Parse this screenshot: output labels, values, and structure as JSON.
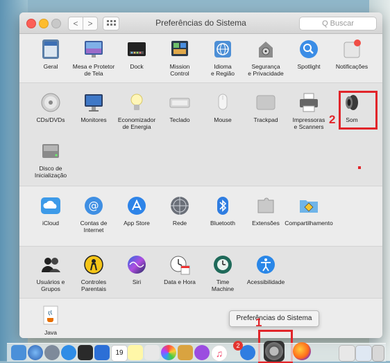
{
  "window": {
    "title": "Preferências do Sistema",
    "search_placeholder": "Q Buscar",
    "back_glyph": "<",
    "forward_glyph": ">"
  },
  "panes": {
    "row1": [
      {
        "label": "Geral",
        "icon": "general-icon"
      },
      {
        "label": "Mesa e Protetor\nde Tela",
        "icon": "desktop-screensaver-icon"
      },
      {
        "label": "Dock",
        "icon": "dock-icon"
      },
      {
        "label": "Mission\nControl",
        "icon": "mission-control-icon"
      },
      {
        "label": "Idioma\ne Região",
        "icon": "language-region-icon"
      },
      {
        "label": "Segurança\ne Privacidade",
        "icon": "security-icon"
      },
      {
        "label": "Spotlight",
        "icon": "spotlight-icon"
      },
      {
        "label": "Notificações",
        "icon": "notifications-icon"
      }
    ],
    "row2": [
      {
        "label": "CDs/DVDs",
        "icon": "cd-dvd-icon"
      },
      {
        "label": "Monitores",
        "icon": "displays-icon"
      },
      {
        "label": "Economizador\nde Energia",
        "icon": "energy-saver-icon"
      },
      {
        "label": "Teclado",
        "icon": "keyboard-icon"
      },
      {
        "label": "Mouse",
        "icon": "mouse-icon"
      },
      {
        "label": "Trackpad",
        "icon": "trackpad-icon"
      },
      {
        "label": "Impressoras\ne Scanners",
        "icon": "printer-icon"
      },
      {
        "label": "Som",
        "icon": "sound-icon"
      }
    ],
    "row2b": [
      {
        "label": "Disco de\nInicialização",
        "icon": "startup-disk-icon"
      }
    ],
    "row3": [
      {
        "label": "iCloud",
        "icon": "icloud-icon"
      },
      {
        "label": "Contas de\nInternet",
        "icon": "internet-accounts-icon"
      },
      {
        "label": "App Store",
        "icon": "app-store-icon"
      },
      {
        "label": "Rede",
        "icon": "network-icon"
      },
      {
        "label": "Bluetooth",
        "icon": "bluetooth-icon"
      },
      {
        "label": "Extensões",
        "icon": "extensions-icon"
      },
      {
        "label": "Compartilhamento",
        "icon": "sharing-icon"
      }
    ],
    "row4": [
      {
        "label": "Usuários e\nGrupos",
        "icon": "users-groups-icon"
      },
      {
        "label": "Controles\nParentais",
        "icon": "parental-controls-icon"
      },
      {
        "label": "Siri",
        "icon": "siri-icon"
      },
      {
        "label": "Data e Hora",
        "icon": "date-time-icon"
      },
      {
        "label": "Time\nMachine",
        "icon": "time-machine-icon"
      },
      {
        "label": "Acessibilidade",
        "icon": "accessibility-icon"
      }
    ],
    "row5": [
      {
        "label": "Java",
        "icon": "java-icon"
      }
    ]
  },
  "annotations": {
    "step1": "1",
    "step2": "2"
  },
  "dock": {
    "tooltip": "Preferências do Sistema",
    "calendar_day": "19",
    "app_store_badge": "2"
  },
  "colors": {
    "annotation_red": "#e1252a",
    "accent_blue": "#2f7de1"
  }
}
